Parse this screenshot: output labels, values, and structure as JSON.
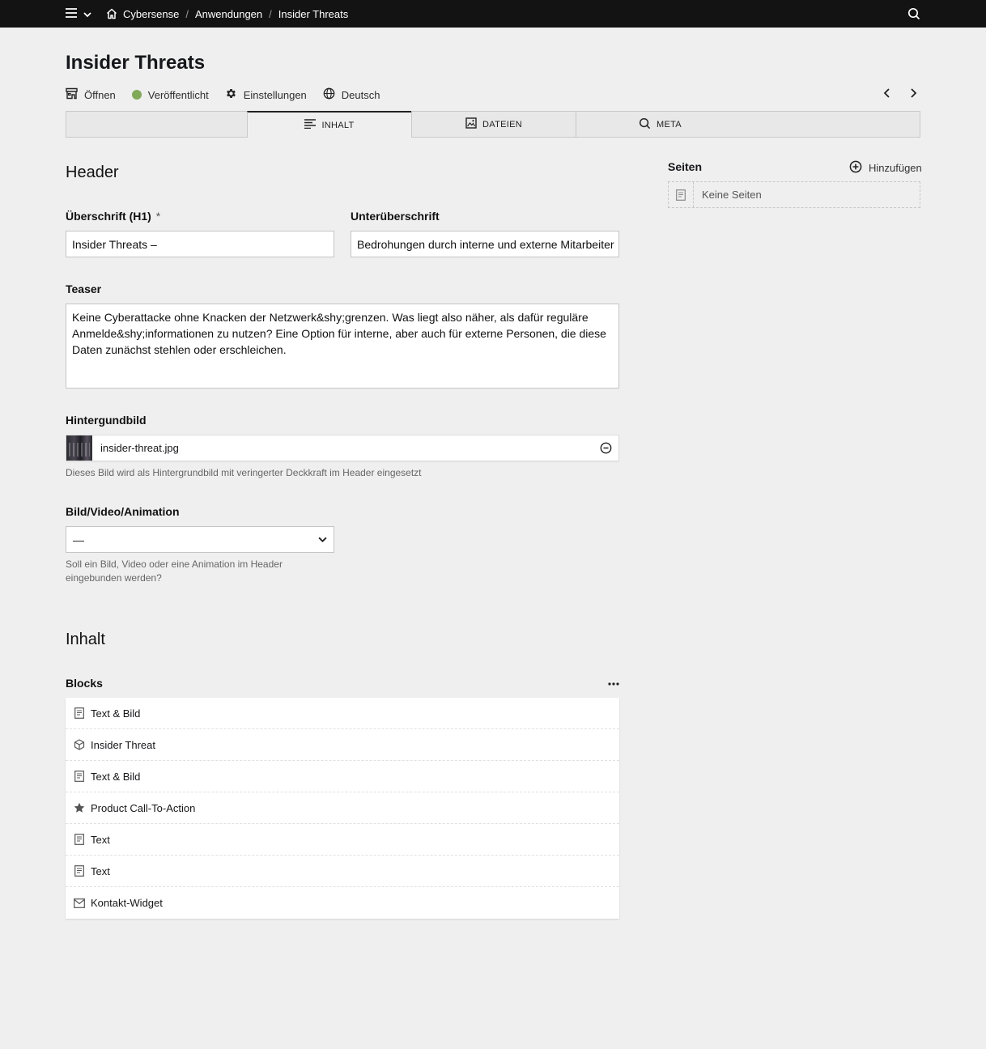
{
  "topbar": {
    "breadcrumb": [
      "Cybersense",
      "Anwendungen",
      "Insider Threats"
    ]
  },
  "page": {
    "title": "Insider Threats"
  },
  "viewbar": {
    "open": "Öffnen",
    "status": "Veröffentlicht",
    "status_color": "#81a95a",
    "settings": "Einstellungen",
    "language": "Deutsch"
  },
  "tabs": [
    {
      "label": "INHALT",
      "icon": "text-lines-icon"
    },
    {
      "label": "DATEIEN",
      "icon": "image-icon"
    },
    {
      "label": "META",
      "icon": "search-icon"
    }
  ],
  "header_section": {
    "title": "Header",
    "h1_label": "Überschrift (H1)",
    "h1_required": "*",
    "h1_value": "Insider Threats –",
    "sub_label": "Unterüberschrift",
    "sub_value": "Bedrohungen durch interne und externe Mitarbeiter",
    "teaser_label": "Teaser",
    "teaser_value": "Keine Cyberattacke ohne Knacken der Netzwerk&shy;grenzen. Was liegt also näher, als dafür reguläre Anmelde&shy;informationen zu nutzen? Eine Option für interne, aber auch für externe Personen, die diese Daten zunächst stehlen oder erschleichen.",
    "bg_label": "Hintergundbild",
    "bg_file": "insider-threat.jpg",
    "bg_hint": "Dieses Bild wird als Hintergrundbild mit veringerter Deckkraft im Header eingesetzt",
    "media_label": "Bild/Video/Animation",
    "media_value": "—",
    "media_hint": "Soll ein Bild, Video oder eine Animation im Header eingebunden werden?"
  },
  "content_section": {
    "title": "Inhalt",
    "blocks_label": "Blocks",
    "blocks": [
      {
        "label": "Text & Bild",
        "icon": "document-icon"
      },
      {
        "label": "Insider Threat",
        "icon": "cube-icon"
      },
      {
        "label": "Text & Bild",
        "icon": "document-icon"
      },
      {
        "label": "Product Call-To-Action",
        "icon": "star-icon"
      },
      {
        "label": "Text",
        "icon": "document-icon"
      },
      {
        "label": "Text",
        "icon": "document-icon"
      },
      {
        "label": "Kontakt-Widget",
        "icon": "envelope-icon"
      }
    ]
  },
  "sidebar": {
    "pages_label": "Seiten",
    "add_label": "Hinzufügen",
    "empty_label": "Keine Seiten"
  }
}
